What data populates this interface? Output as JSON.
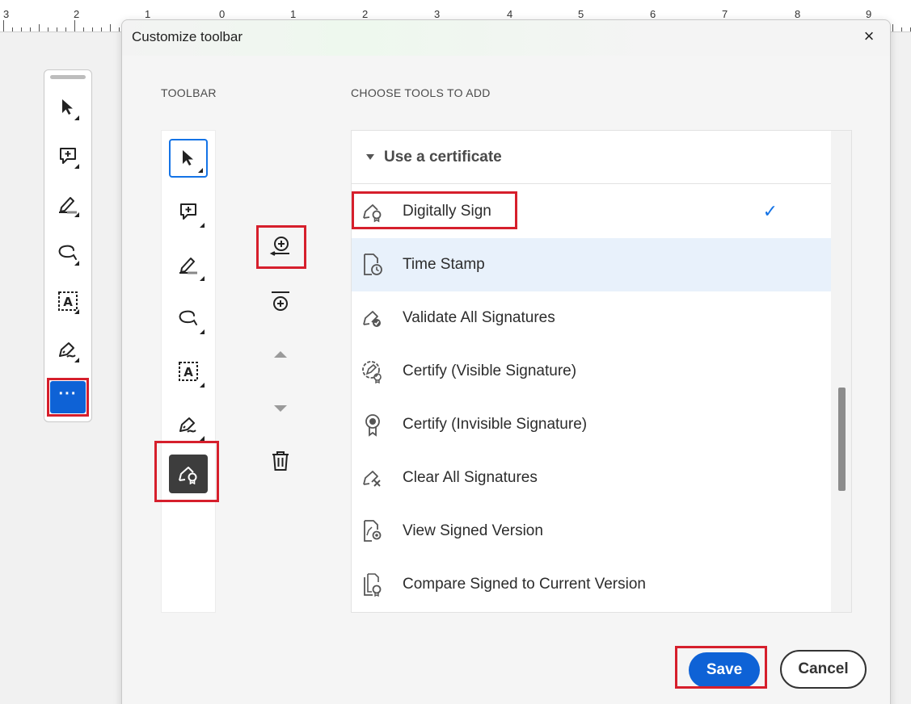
{
  "ruler": {
    "numbers": [
      "3",
      "2",
      "1",
      "0",
      "1",
      "2",
      "3",
      "4",
      "5",
      "6",
      "7",
      "8",
      "9"
    ]
  },
  "floating_toolbar": {
    "tools": [
      "select-icon",
      "add-comment-icon",
      "highlight-icon",
      "draw-freeform-icon",
      "text-recognition-icon",
      "sign-pen-icon"
    ],
    "more_label": "···"
  },
  "dialog": {
    "title": "Customize toolbar",
    "close_label": "×",
    "toolbar_label": "TOOLBAR",
    "choose_label": "CHOOSE TOOLS TO ADD",
    "toolbar_items": [
      "select-icon",
      "add-comment-icon",
      "highlight-icon",
      "draw-freeform-icon",
      "text-recognition-icon",
      "sign-pen-icon",
      "digitally-sign-icon"
    ],
    "group_title": "Use a certificate",
    "tools": [
      {
        "label": "Digitally Sign",
        "icon": "digitally-sign-icon",
        "checked": true
      },
      {
        "label": "Time Stamp",
        "icon": "time-stamp-icon",
        "highlighted": true
      },
      {
        "label": "Validate All Signatures",
        "icon": "validate-signatures-icon"
      },
      {
        "label": "Certify (Visible Signature)",
        "icon": "certify-visible-icon"
      },
      {
        "label": "Certify (Invisible Signature)",
        "icon": "certify-invisible-icon"
      },
      {
        "label": "Clear All Signatures",
        "icon": "clear-signatures-icon"
      },
      {
        "label": "View Signed Version",
        "icon": "view-signed-icon"
      },
      {
        "label": "Compare Signed to Current Version",
        "icon": "compare-signed-icon"
      }
    ],
    "check_mark": "✓",
    "save_label": "Save",
    "cancel_label": "Cancel"
  },
  "colors": {
    "accent": "#0e62d6",
    "highlight_box": "#d61f2c",
    "selected_row": "#e8f1fb"
  }
}
